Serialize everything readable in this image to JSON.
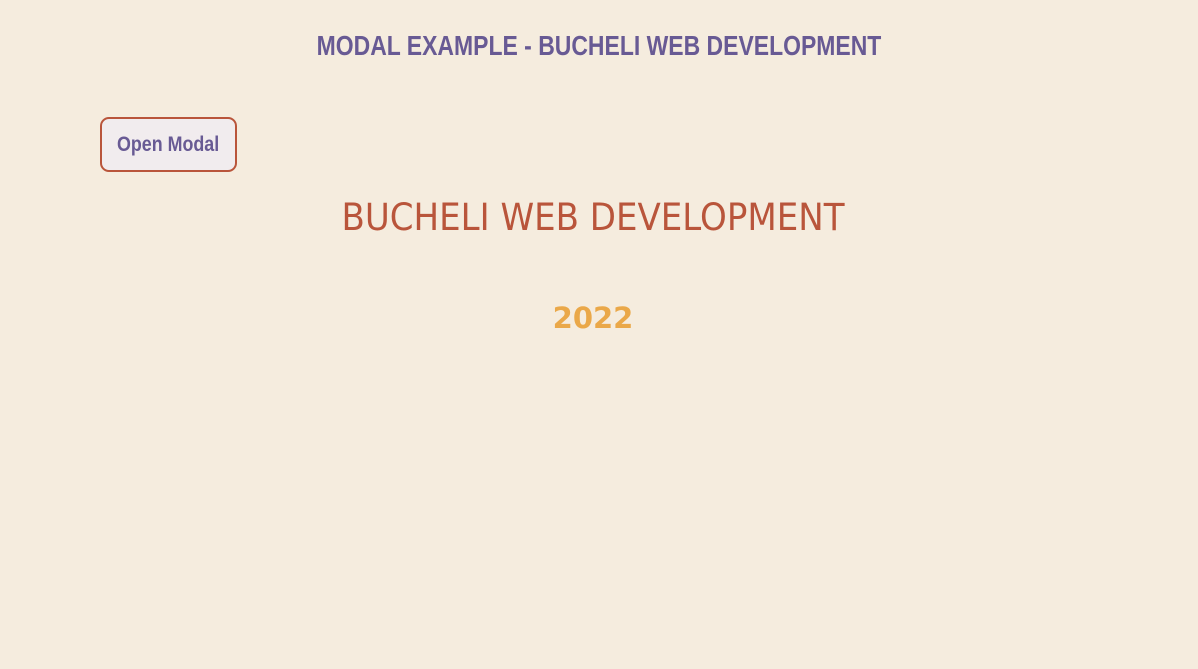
{
  "header": {
    "title": "MODAL EXAMPLE - BUCHELI WEB DEVELOPMENT"
  },
  "actions": {
    "open_modal_label": "Open Modal"
  },
  "main": {
    "brand_heading": "BUCHELI WEB DEVELOPMENT",
    "year": "2022"
  },
  "colors": {
    "background": "#f5ecde",
    "title": "#685a94",
    "brand": "#b9553b",
    "year": "#eaa849",
    "button_border": "#b9553b",
    "button_background": "#f1ecee"
  }
}
